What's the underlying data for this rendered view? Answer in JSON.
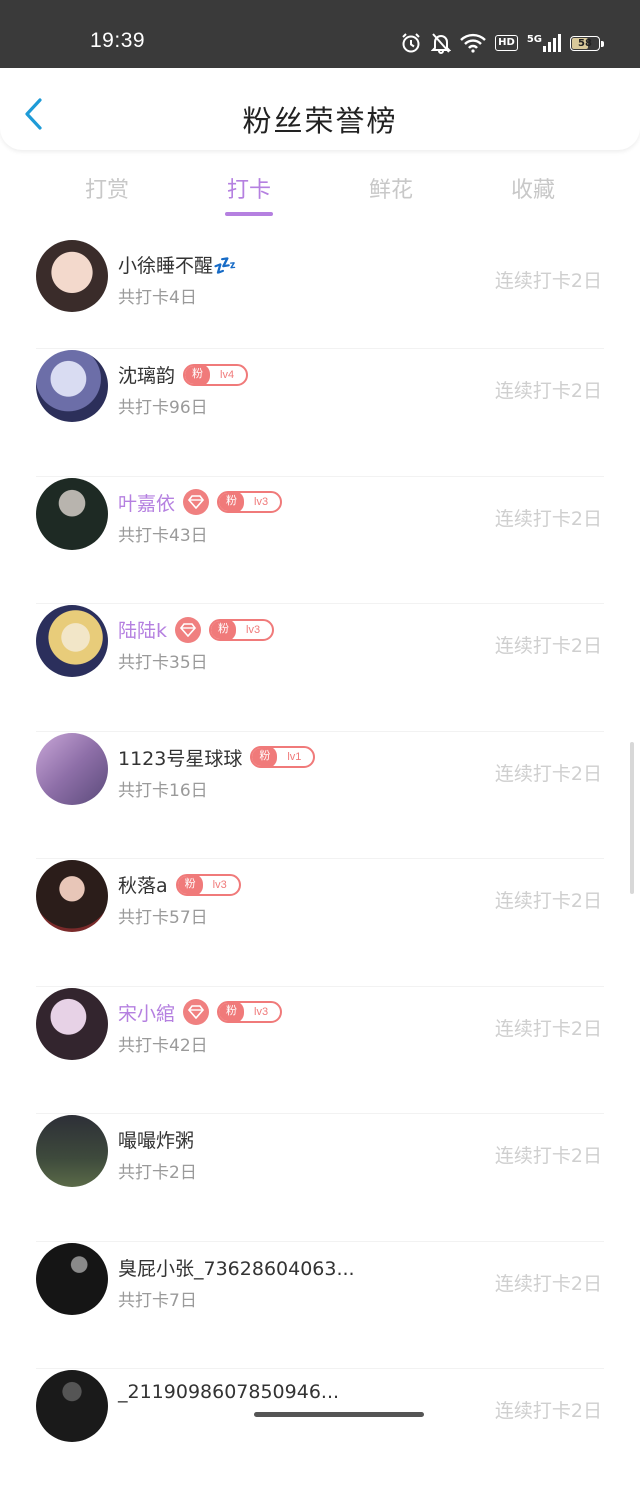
{
  "status_bar": {
    "time": "19:39",
    "icons": [
      "alarm-icon",
      "bell-off-icon",
      "wifi-icon",
      "hd-icon",
      "5g-signal-icon",
      "battery-icon"
    ],
    "hd": "HD",
    "network": "5G",
    "battery": "58"
  },
  "header": {
    "title": "粉丝荣誉榜",
    "back_icon": "back-arrow-icon"
  },
  "tabs": [
    {
      "label": "打赏",
      "active": false
    },
    {
      "label": "打卡",
      "active": true
    },
    {
      "label": "鲜花",
      "active": false
    },
    {
      "label": "收藏",
      "active": false
    }
  ],
  "colors": {
    "accent": "#b580e0",
    "badge": "#f07a7a",
    "muted": "#cfcfcf"
  },
  "fan_badge_label": "粉",
  "list": [
    {
      "name": "小徐睡不醒💤",
      "total": "共打卡4日",
      "streak": "连续打卡2日",
      "vip": false,
      "level": null,
      "purple": false
    },
    {
      "name": "沈璃韵",
      "total": "共打卡96日",
      "streak": "连续打卡2日",
      "vip": false,
      "level": "lv4",
      "purple": false
    },
    {
      "name": "叶嘉依",
      "total": "共打卡43日",
      "streak": "连续打卡2日",
      "vip": true,
      "level": "lv3",
      "purple": true
    },
    {
      "name": "陆陆k",
      "total": "共打卡35日",
      "streak": "连续打卡2日",
      "vip": true,
      "level": "lv3",
      "purple": true
    },
    {
      "name": "1123号星球球",
      "total": "共打卡16日",
      "streak": "连续打卡2日",
      "vip": false,
      "level": "lv1",
      "purple": false
    },
    {
      "name": "秋落a",
      "total": "共打卡57日",
      "streak": "连续打卡2日",
      "vip": false,
      "level": "lv3",
      "purple": false
    },
    {
      "name": "宋小綰",
      "total": "共打卡42日",
      "streak": "连续打卡2日",
      "vip": true,
      "level": "lv3",
      "purple": true
    },
    {
      "name": "嘬嘬炸粥",
      "total": "共打卡2日",
      "streak": "连续打卡2日",
      "vip": false,
      "level": null,
      "purple": false
    },
    {
      "name": "臭屁小张_73628604063...",
      "total": "共打卡7日",
      "streak": "连续打卡2日",
      "vip": false,
      "level": null,
      "purple": false
    },
    {
      "name": "_2119098607850946...",
      "total": "",
      "streak": "连续打卡2日",
      "vip": false,
      "level": null,
      "purple": false
    }
  ]
}
